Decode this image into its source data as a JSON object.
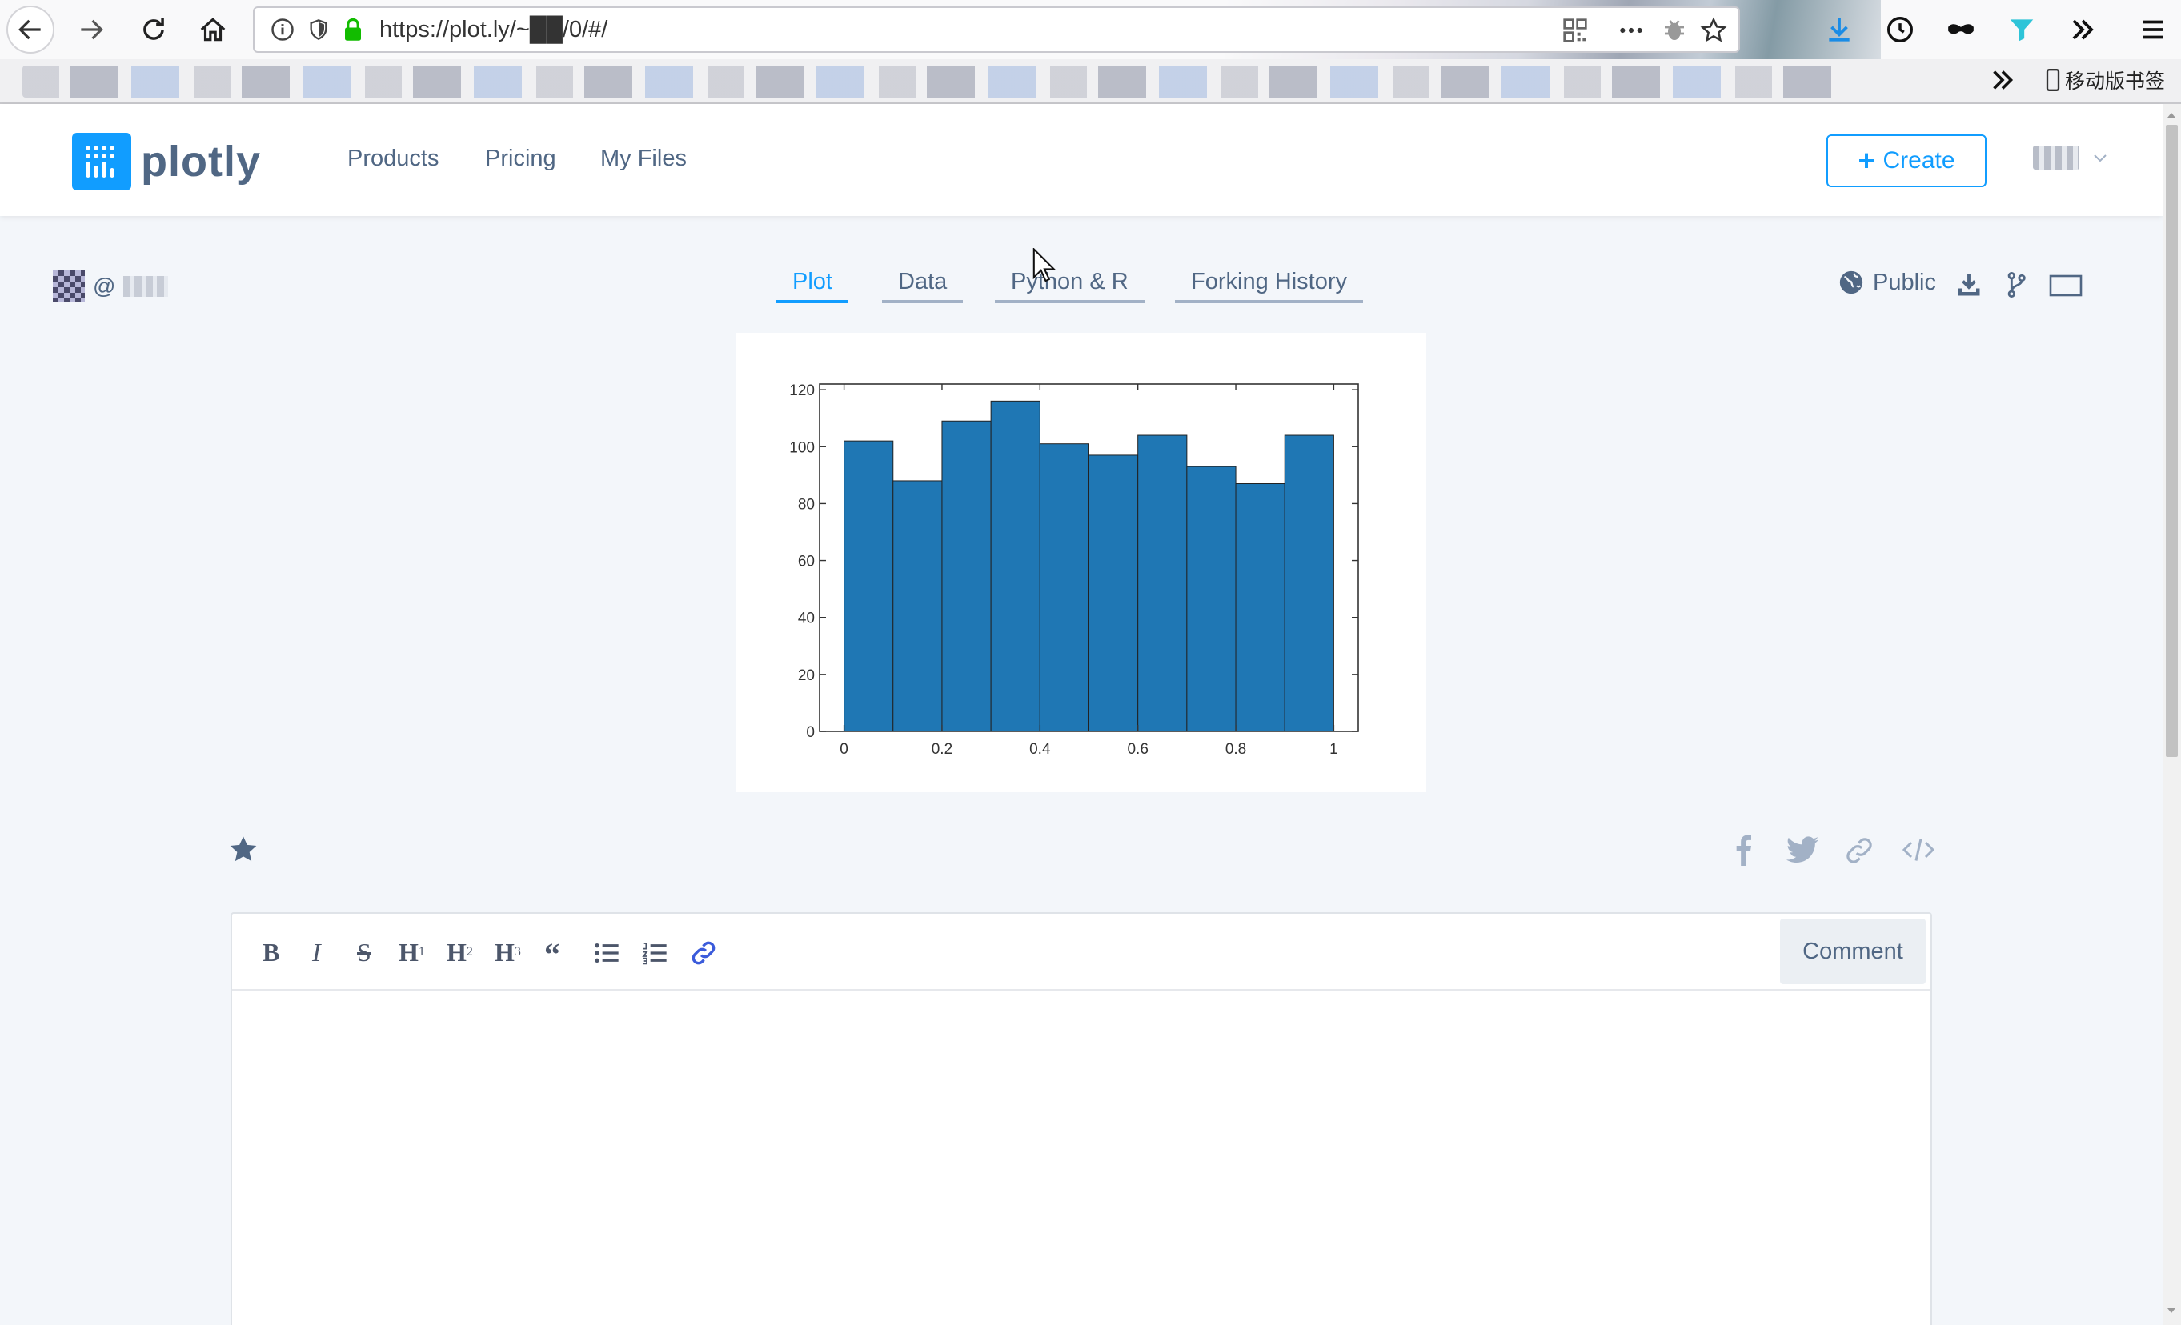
{
  "browser": {
    "url": "https://plot.ly/~██/0/#/",
    "mobile_bookmarks_label": "移动版书签"
  },
  "site": {
    "logo_text": "plotly",
    "nav": [
      "Products",
      "Pricing",
      "My Files"
    ],
    "create_label": "Create"
  },
  "plot_page": {
    "owner_prefix": "@",
    "tabs": [
      "Plot",
      "Data",
      "Python & R",
      "Forking History"
    ],
    "active_tab": "Plot",
    "visibility_label": "Public"
  },
  "comment_editor": {
    "toolbar": [
      "B",
      "I",
      "S",
      "H1",
      "H2",
      "H3",
      "“"
    ],
    "comment_button_label": "Comment",
    "body_text": ""
  },
  "colors": {
    "accent": "#119dff",
    "text": "#506784",
    "page_bg": "#f3f6fa",
    "bar_fill": "#1f77b4"
  },
  "icons": [
    "back-icon",
    "forward-icon",
    "reload-icon",
    "home-icon",
    "info-icon",
    "shield-icon",
    "lock-icon",
    "qr-code-icon",
    "more-icon",
    "bug-icon",
    "bookmark-star-icon",
    "download-icon",
    "history-icon",
    "private-icon",
    "filter-icon",
    "overflow-icon",
    "menu-icon",
    "globe-icon",
    "fork-icon",
    "fullscreen-icon",
    "star-icon",
    "facebook-icon",
    "twitter-icon",
    "link-icon",
    "embed-icon",
    "bulleted-list-icon",
    "numbered-list-icon",
    "hyperlink-icon"
  ],
  "chart_data": {
    "type": "bar",
    "bin_edges": [
      0,
      0.1,
      0.2,
      0.3,
      0.4,
      0.5,
      0.6,
      0.7,
      0.8,
      0.9,
      1.0
    ],
    "values": [
      102,
      88,
      109,
      116,
      101,
      97,
      104,
      93,
      87,
      104
    ],
    "x_ticks": [
      0,
      0.2,
      0.4,
      0.6,
      0.8,
      1
    ],
    "x_tick_labels": [
      "0",
      "0.2",
      "0.4",
      "0.6",
      "0.8",
      "1"
    ],
    "y_ticks": [
      0,
      20,
      40,
      60,
      80,
      100,
      120
    ],
    "y_tick_labels": [
      "0",
      "20",
      "40",
      "60",
      "80",
      "100",
      "120"
    ],
    "xlim": [
      -0.05,
      1.05
    ],
    "ylim": [
      0,
      122
    ],
    "title": "",
    "xlabel": "",
    "ylabel": "",
    "grid": false,
    "legend": "none"
  }
}
